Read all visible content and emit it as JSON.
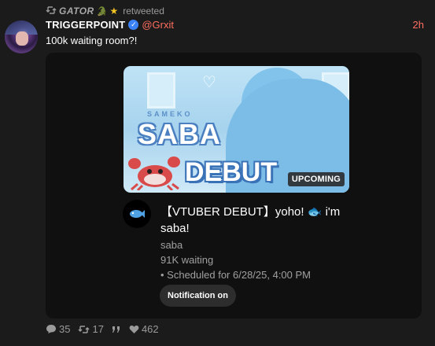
{
  "retweet": {
    "icon": "retweet-icon",
    "name": "GATOR",
    "emoji": "🐊",
    "star": "★",
    "label": "retweeted"
  },
  "tweet": {
    "display_name": "TRIGGERPOINT",
    "handle": "@Grxit",
    "timestamp": "2h",
    "text": "100k waiting room?!"
  },
  "embed": {
    "thumbnail_badge": "UPCOMING",
    "thumb_logo_small": "SAMEKO",
    "thumb_logo": "SABA",
    "thumb_debut": "DEBUT",
    "title_part1": "【VTUBER DEBUT】yoho! ",
    "title_fish": "🐟",
    "title_part2": " i'm saba!",
    "channel": "saba",
    "waiting": "91K waiting",
    "scheduled": "• Scheduled for 6/28/25, 4:00 PM",
    "notification_button": "Notification on"
  },
  "stats": {
    "replies": "35",
    "retweets": "17",
    "likes": "462"
  },
  "colors": {
    "accent": "#ff6f61",
    "verified": "#3b82f6",
    "background": "#1b1b1b",
    "embed_bg": "#101010"
  }
}
